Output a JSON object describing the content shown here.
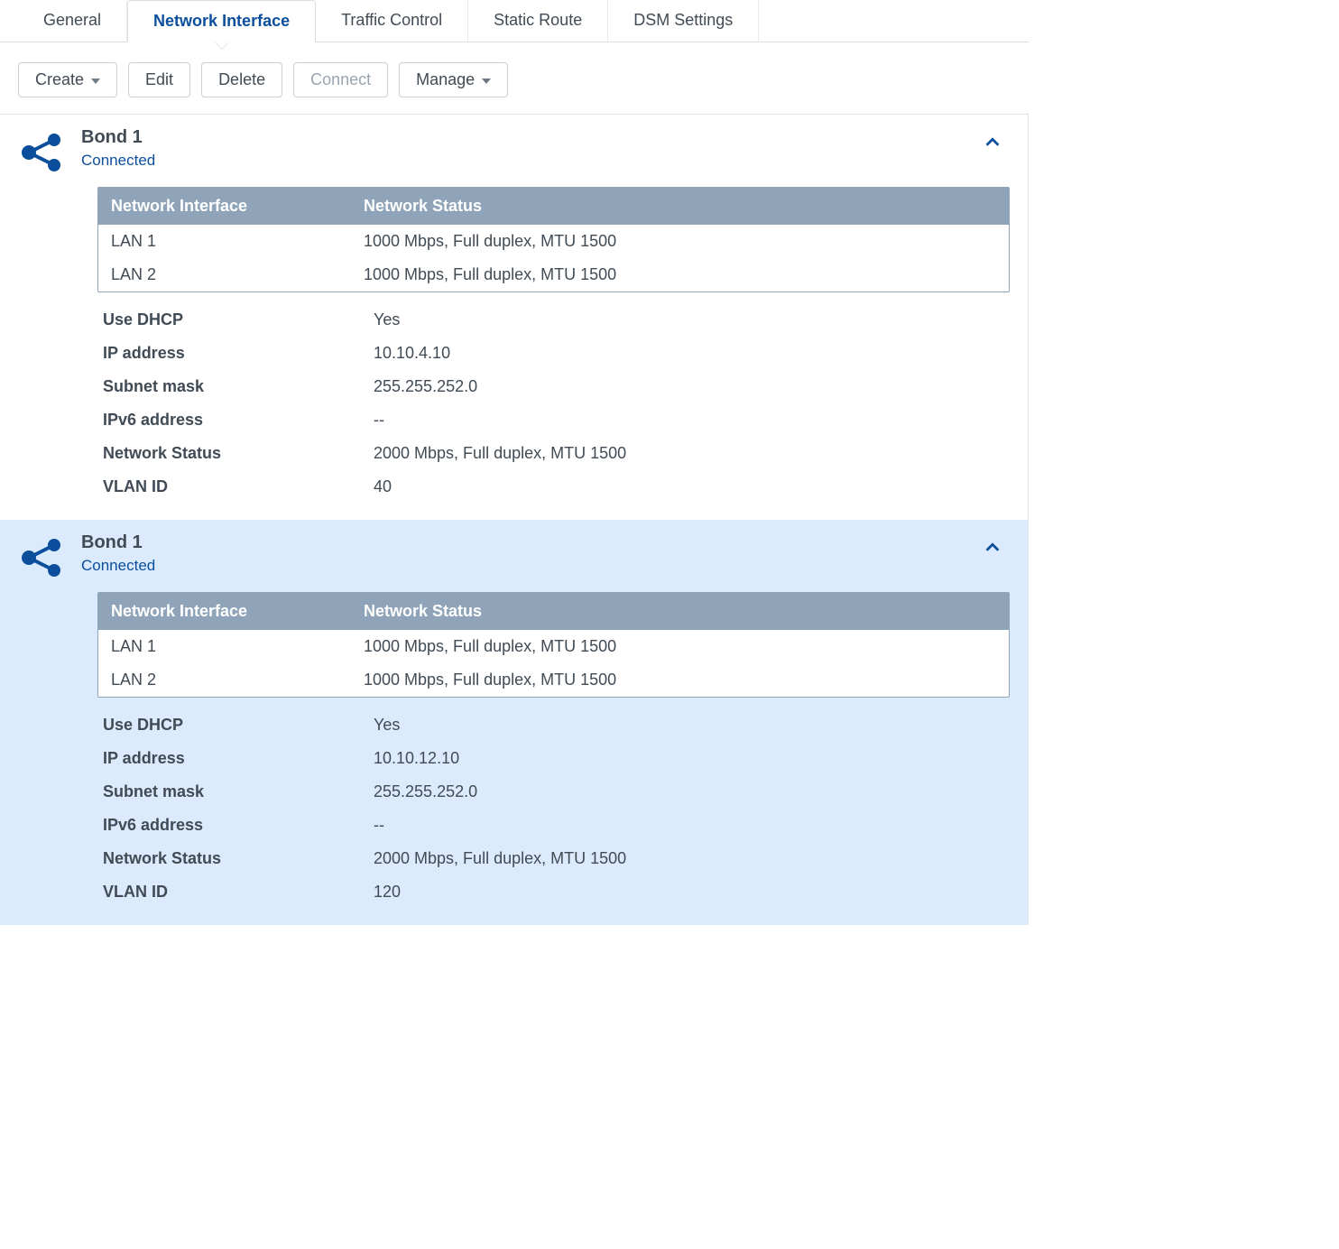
{
  "tabs": [
    {
      "label": "General"
    },
    {
      "label": "Network Interface"
    },
    {
      "label": "Traffic Control"
    },
    {
      "label": "Static Route"
    },
    {
      "label": "DSM Settings"
    }
  ],
  "active_tab_index": 1,
  "toolbar": {
    "create": "Create",
    "edit": "Edit",
    "delete": "Delete",
    "connect": "Connect",
    "manage": "Manage"
  },
  "table_headers": {
    "iface": "Network Interface",
    "status": "Network Status"
  },
  "prop_labels": {
    "dhcp": "Use DHCP",
    "ip": "IP address",
    "mask": "Subnet mask",
    "ipv6": "IPv6 address",
    "netstat": "Network Status",
    "vlan": "VLAN ID"
  },
  "items": [
    {
      "title": "Bond 1",
      "status": "Connected",
      "selected": false,
      "ifaces": [
        {
          "name": "LAN 1",
          "status": "1000 Mbps, Full duplex, MTU 1500"
        },
        {
          "name": "LAN 2",
          "status": "1000 Mbps, Full duplex, MTU 1500"
        }
      ],
      "props": {
        "dhcp": "Yes",
        "ip": "10.10.4.10",
        "mask": "255.255.252.0",
        "ipv6": "--",
        "netstat": "2000 Mbps, Full duplex, MTU 1500",
        "vlan": "40"
      }
    },
    {
      "title": "Bond 1",
      "status": "Connected",
      "selected": true,
      "ifaces": [
        {
          "name": "LAN 1",
          "status": "1000 Mbps, Full duplex, MTU 1500"
        },
        {
          "name": "LAN 2",
          "status": "1000 Mbps, Full duplex, MTU 1500"
        }
      ],
      "props": {
        "dhcp": "Yes",
        "ip": "10.10.12.10",
        "mask": "255.255.252.0",
        "ipv6": "--",
        "netstat": "2000 Mbps, Full duplex, MTU 1500",
        "vlan": "120"
      }
    }
  ]
}
